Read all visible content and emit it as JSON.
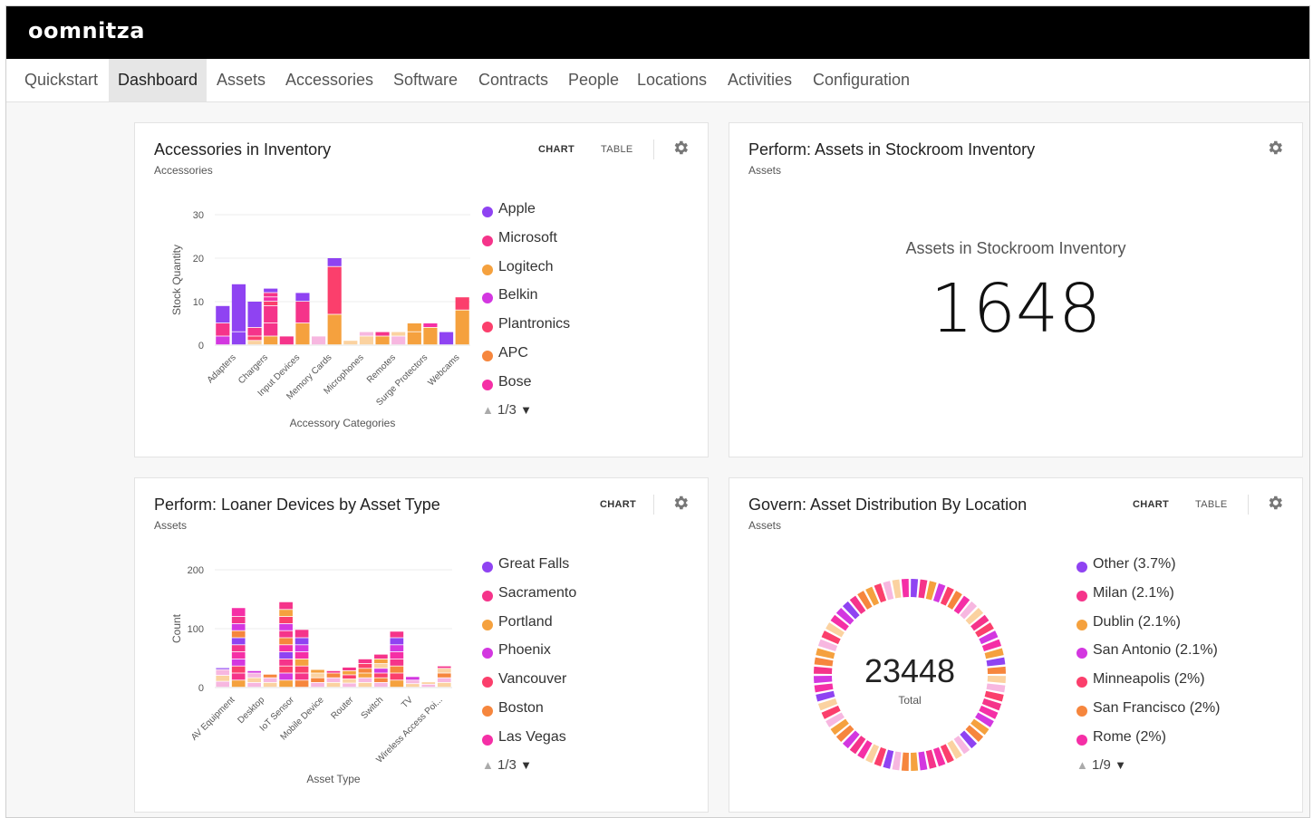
{
  "app": {
    "logo": "oomnitza"
  },
  "nav": [
    "Quickstart",
    "Dashboard",
    "Assets",
    "Accessories",
    "Software",
    "Contracts",
    "People",
    "Locations",
    "Activities",
    "Configuration"
  ],
  "nav_active": "Dashboard",
  "colors": [
    "#8f43f2",
    "#f5348a",
    "#f5a13e",
    "#d337e0",
    "#fb3f6c",
    "#f6863d",
    "#f52fa6",
    "#f7b7e0",
    "#fbd2a0"
  ],
  "cards": {
    "accessories": {
      "title": "Accessories in Inventory",
      "subtitle": "Accessories",
      "chart_tab": "CHART",
      "table_tab": "TABLE",
      "settings_icon": "gear-icon",
      "legend": [
        "Apple",
        "Microsoft",
        "Logitech",
        "Belkin",
        "Plantronics",
        "APC",
        "Bose"
      ],
      "pager": "1/3"
    },
    "stockroom": {
      "title": "Perform: Assets in Stockroom Inventory",
      "subtitle": "Assets",
      "settings_icon": "gear-icon",
      "label": "Assets in Stockroom Inventory",
      "value": "1648"
    },
    "loaner": {
      "title": "Perform: Loaner Devices by Asset Type",
      "subtitle": "Assets",
      "chart_tab": "CHART",
      "settings_icon": "gear-icon",
      "legend": [
        "Great Falls",
        "Sacramento",
        "Portland",
        "Phoenix",
        "Vancouver",
        "Boston",
        "Las Vegas"
      ],
      "pager": "1/3"
    },
    "location": {
      "title": "Govern: Asset Distribution By Location",
      "subtitle": "Assets",
      "chart_tab": "CHART",
      "table_tab": "TABLE",
      "settings_icon": "gear-icon",
      "legend": [
        "Other (3.7%)",
        "Milan (2.1%)",
        "Dublin (2.1%)",
        "San Antonio (2.1%)",
        "Minneapolis (2%)",
        "San Francisco (2%)",
        "Rome (2%)"
      ],
      "pager": "1/9",
      "total_value": "23448",
      "total_label": "Total"
    }
  },
  "chart_data": [
    {
      "type": "bar",
      "stacked": true,
      "xlabel": "Accessory Categories",
      "ylabel": "Stock Quantity",
      "ylim": [
        0,
        30
      ],
      "yticks": [
        0,
        10,
        20,
        30
      ],
      "categories": [
        "Adapters",
        "Chargers",
        "Input Devices",
        "Memory Cards",
        "Microphones",
        "Remotes",
        "Surge Protectors",
        "Webcams"
      ],
      "bars": [
        {
          "stack": [
            [
              2,
              3
            ],
            [
              3,
              1
            ],
            [
              4,
              0
            ]
          ]
        },
        {
          "stack": [
            [
              3,
              0
            ],
            [
              11,
              0
            ]
          ]
        },
        {
          "stack": [
            [
              1,
              8
            ],
            [
              1,
              4
            ],
            [
              2,
              1
            ],
            [
              6,
              0
            ]
          ]
        },
        {
          "stack": [
            [
              2,
              2
            ],
            [
              3,
              1
            ],
            [
              4,
              1
            ],
            [
              1,
              4
            ],
            [
              1,
              6
            ],
            [
              1,
              1
            ],
            [
              1,
              0
            ]
          ]
        },
        {
          "stack": [
            [
              2,
              1
            ]
          ]
        },
        {
          "stack": [
            [
              5,
              2
            ],
            [
              5,
              1
            ],
            [
              2,
              0
            ]
          ]
        },
        {
          "stack": [
            [
              2,
              7
            ]
          ]
        },
        {
          "stack": [
            [
              7,
              2
            ],
            [
              11,
              4
            ],
            [
              2,
              0
            ]
          ]
        },
        {
          "stack": [
            [
              1,
              8
            ]
          ]
        },
        {
          "stack": [
            [
              2,
              8
            ],
            [
              1,
              7
            ]
          ]
        },
        {
          "stack": [
            [
              2,
              2
            ],
            [
              1,
              1
            ]
          ]
        },
        {
          "stack": [
            [
              2,
              7
            ],
            [
              1,
              8
            ]
          ]
        },
        {
          "stack": [
            [
              3,
              2
            ],
            [
              2,
              2
            ]
          ]
        },
        {
          "stack": [
            [
              4,
              2
            ],
            [
              1,
              6
            ]
          ]
        },
        {
          "stack": [
            [
              3,
              0
            ]
          ]
        },
        {
          "stack": [
            [
              8,
              2
            ],
            [
              3,
              4
            ]
          ]
        }
      ]
    },
    {
      "type": "bar",
      "stacked": true,
      "xlabel": "Asset Type",
      "ylabel": "Count",
      "ylim": [
        0,
        200
      ],
      "yticks": [
        0,
        100,
        200
      ],
      "categories": [
        "AV Equipment",
        "Desktop",
        "IoT Sensor",
        "Mobile Device",
        "Router",
        "Switch",
        "TV",
        "Wireless Access Poi..."
      ],
      "bars": [
        {
          "stack": [
            [
              10,
              7
            ],
            [
              10,
              8
            ],
            [
              10,
              7
            ],
            [
              3,
              0
            ]
          ]
        },
        {
          "stack": [
            [
              12,
              2
            ],
            [
              12,
              1
            ],
            [
              12,
              4
            ],
            [
              12,
              3
            ],
            [
              12,
              6
            ],
            [
              12,
              1
            ],
            [
              12,
              0
            ],
            [
              12,
              5
            ],
            [
              12,
              3
            ],
            [
              12,
              1
            ],
            [
              15,
              6
            ]
          ]
        },
        {
          "stack": [
            [
              8,
              7
            ],
            [
              8,
              8
            ],
            [
              8,
              7
            ],
            [
              4,
              3
            ]
          ]
        },
        {
          "stack": [
            [
              8,
              8
            ],
            [
              8,
              7
            ],
            [
              6,
              5
            ]
          ]
        },
        {
          "stack": [
            [
              12,
              2
            ],
            [
              12,
              3
            ],
            [
              12,
              4
            ],
            [
              12,
              1
            ],
            [
              12,
              0
            ],
            [
              12,
              6
            ],
            [
              12,
              5
            ],
            [
              12,
              1
            ],
            [
              12,
              3
            ],
            [
              12,
              4
            ],
            [
              12,
              2
            ],
            [
              13,
              1
            ]
          ]
        },
        {
          "stack": [
            [
              12,
              5
            ],
            [
              12,
              1
            ],
            [
              12,
              4
            ],
            [
              12,
              2
            ],
            [
              12,
              6
            ],
            [
              12,
              3
            ],
            [
              12,
              0
            ],
            [
              14,
              1
            ]
          ]
        },
        {
          "stack": [
            [
              8,
              7
            ],
            [
              8,
              5
            ],
            [
              8,
              8
            ],
            [
              6,
              2
            ]
          ]
        },
        {
          "stack": [
            [
              8,
              8
            ],
            [
              8,
              7
            ],
            [
              8,
              5
            ],
            [
              4,
              1
            ]
          ]
        },
        {
          "stack": [
            [
              7,
              7
            ],
            [
              7,
              8
            ],
            [
              7,
              4
            ],
            [
              7,
              2
            ],
            [
              6,
              1
            ]
          ]
        },
        {
          "stack": [
            [
              8,
              8
            ],
            [
              8,
              7
            ],
            [
              8,
              2
            ],
            [
              8,
              5
            ],
            [
              8,
              4
            ],
            [
              8,
              1
            ]
          ]
        },
        {
          "stack": [
            [
              8,
              7
            ],
            [
              8,
              5
            ],
            [
              8,
              4
            ],
            [
              8,
              3
            ],
            [
              8,
              8
            ],
            [
              8,
              2
            ],
            [
              8,
              1
            ]
          ]
        },
        {
          "stack": [
            [
              12,
              2
            ],
            [
              12,
              4
            ],
            [
              12,
              5
            ],
            [
              12,
              1
            ],
            [
              12,
              6
            ],
            [
              12,
              3
            ],
            [
              12,
              0
            ],
            [
              11,
              1
            ]
          ]
        },
        {
          "stack": [
            [
              6,
              8
            ],
            [
              6,
              7
            ],
            [
              6,
              3
            ]
          ]
        },
        {
          "stack": [
            [
              5,
              7
            ],
            [
              4,
              8
            ]
          ]
        },
        {
          "stack": [
            [
              8,
              8
            ],
            [
              8,
              7
            ],
            [
              8,
              5
            ],
            [
              8,
              8
            ],
            [
              4,
              1
            ]
          ]
        }
      ]
    },
    {
      "type": "pie",
      "donut": true,
      "total": 23448,
      "legend": [
        "Other (3.7%)",
        "Milan (2.1%)",
        "Dublin (2.1%)",
        "San Antonio (2.1%)",
        "Minneapolis (2%)",
        "San Francisco (2%)",
        "Rome (2%)"
      ],
      "values": [
        3.7,
        2.1,
        2.1,
        2.1,
        2,
        2,
        2
      ],
      "segment_count": 64
    }
  ]
}
